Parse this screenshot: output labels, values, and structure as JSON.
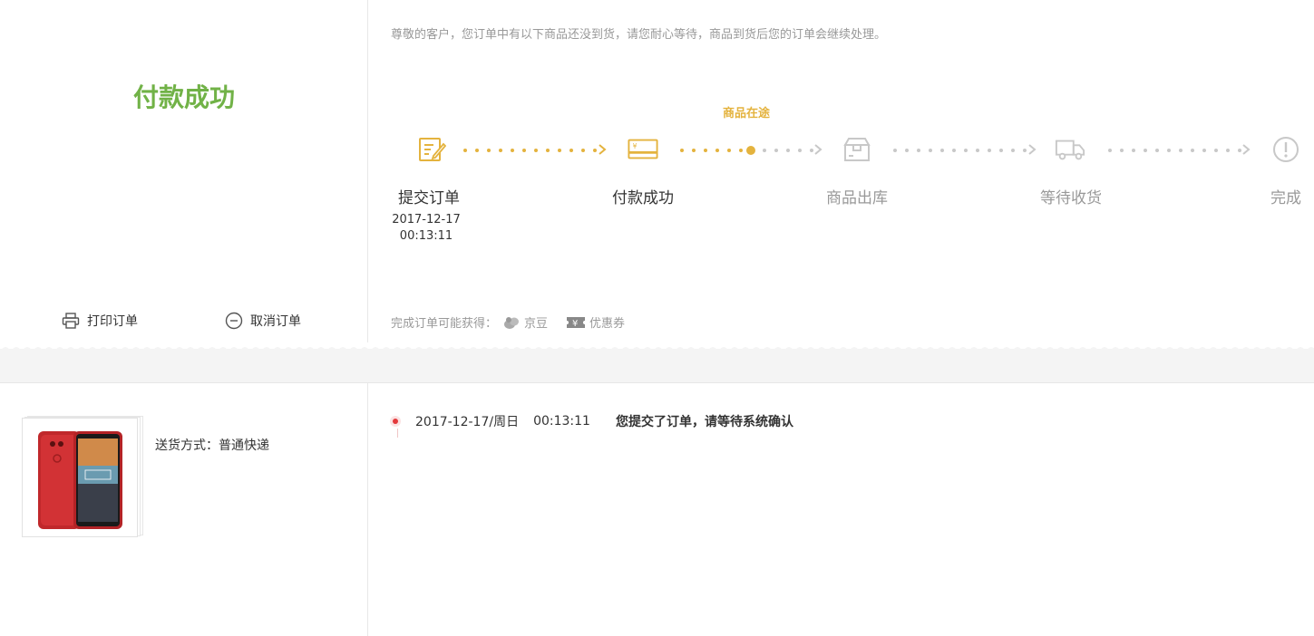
{
  "status": {
    "title": "付款成功",
    "actions": [
      {
        "label": "打印订单",
        "icon": "printer-icon"
      },
      {
        "label": "取消订单",
        "icon": "minus-circle-icon"
      }
    ]
  },
  "notice": "尊敬的客户，您订单中有以下商品还没到货，请您耐心等待，商品到货后您的订单会继续处理。",
  "progress": {
    "current_label": "商品在途",
    "steps": [
      {
        "name": "提交订单",
        "date": "2017-12-17",
        "time": "00:13:11",
        "icon": "edit-document-icon",
        "state": "done"
      },
      {
        "name": "付款成功",
        "date": "",
        "time": "",
        "icon": "payment-card-icon",
        "state": "done"
      },
      {
        "name": "商品出库",
        "date": "",
        "time": "",
        "icon": "box-icon",
        "state": "pending"
      },
      {
        "name": "等待收货",
        "date": "",
        "time": "",
        "icon": "truck-icon",
        "state": "pending"
      },
      {
        "name": "完成",
        "date": "",
        "time": "",
        "icon": "exclamation-circle-icon",
        "state": "pending"
      }
    ]
  },
  "benefits": {
    "label": "完成订单可能获得：",
    "items": [
      {
        "label": "京豆",
        "icon": "beans-icon"
      },
      {
        "label": "优惠券",
        "icon": "coupon-icon"
      }
    ]
  },
  "shipment": {
    "delivery": "送货方式：普通快递"
  },
  "tracking": [
    {
      "date": "2017-12-17/周日",
      "time": "00:13:11",
      "text": "您提交了订单，请等待系统确认"
    }
  ],
  "colors": {
    "success": "#71b247",
    "accent": "#e4b33e",
    "pending": "#c8c8c8",
    "track_dot": "#e4393c"
  }
}
